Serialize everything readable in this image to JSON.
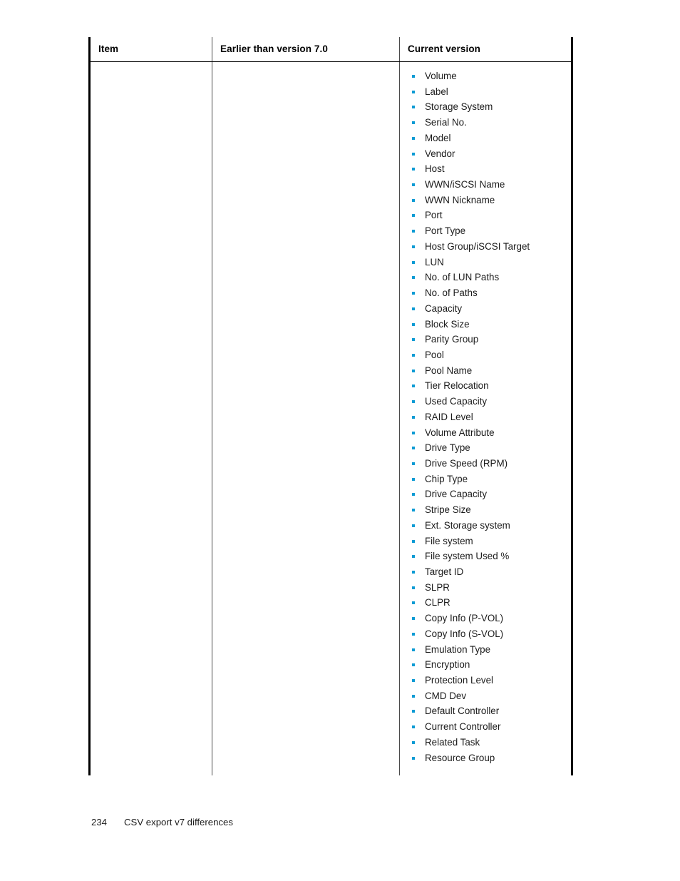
{
  "document": {
    "table": {
      "columns": [
        {
          "key": "item",
          "label": "Item"
        },
        {
          "key": "earlier",
          "label": "Earlier than version 7.0"
        },
        {
          "key": "current",
          "label": "Current version"
        }
      ],
      "row": {
        "item": "",
        "earlier": "",
        "current_items": [
          "Volume",
          "Label",
          "Storage System",
          "Serial No.",
          "Model",
          "Vendor",
          "Host",
          "WWN/iSCSI Name",
          "WWN Nickname",
          "Port",
          "Port Type",
          "Host Group/iSCSI Target",
          "LUN",
          "No. of LUN Paths",
          "No. of Paths",
          "Capacity",
          "Block Size",
          "Parity Group",
          "Pool",
          "Pool Name",
          "Tier Relocation",
          "Used Capacity",
          "RAID Level",
          "Volume Attribute",
          "Drive Type",
          "Drive Speed (RPM)",
          "Chip Type",
          "Drive Capacity",
          "Stripe Size",
          "Ext. Storage system",
          "File system",
          "File system Used %",
          "Target ID",
          "SLPR",
          "CLPR",
          "Copy Info (P-VOL)",
          "Copy Info (S-VOL)",
          "Emulation Type",
          "Encryption",
          "Protection Level",
          "CMD Dev",
          "Default Controller",
          "Current Controller",
          "Related Task",
          "Resource Group"
        ]
      }
    },
    "footer": {
      "page_number": "234",
      "section_title": "CSV export v7 differences"
    },
    "colors": {
      "bullet": "#0b9bd4",
      "rule": "#000000",
      "text": "#1b1b1b"
    }
  }
}
